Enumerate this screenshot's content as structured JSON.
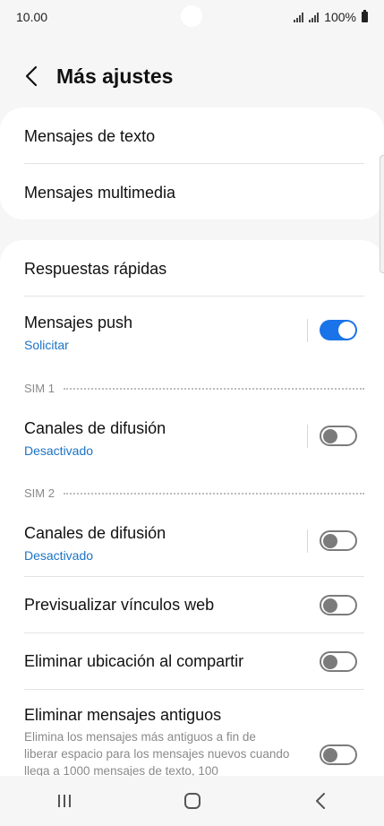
{
  "status_bar": {
    "time": "10.00",
    "battery": "100%"
  },
  "header": {
    "title": "Más ajustes"
  },
  "card1": {
    "items": [
      {
        "title": "Mensajes de texto"
      },
      {
        "title": "Mensajes multimedia"
      }
    ]
  },
  "card2": {
    "quick_replies": "Respuestas rápidas",
    "push": {
      "title": "Mensajes push",
      "subtitle": "Solicitar",
      "enabled": true
    },
    "sim1": {
      "label": "SIM 1",
      "broadcast": {
        "title": "Canales de difusión",
        "subtitle": "Desactivado",
        "enabled": false
      }
    },
    "sim2": {
      "label": "SIM 2",
      "broadcast": {
        "title": "Canales de difusión",
        "subtitle": "Desactivado",
        "enabled": false
      }
    },
    "preview_links": {
      "title": "Previsualizar vínculos web",
      "enabled": false
    },
    "remove_location": {
      "title": "Eliminar ubicación al compartir",
      "enabled": false
    },
    "delete_old": {
      "title": "Eliminar mensajes antiguos",
      "description": "Elimina los mensajes más antiguos a fin de liberar espacio para los mensajes nuevos cuando llega a 1000 mensajes de texto, 100",
      "enabled": false
    }
  },
  "colors": {
    "accent": "#1a73e8",
    "subtitle": "#1b73c4"
  }
}
